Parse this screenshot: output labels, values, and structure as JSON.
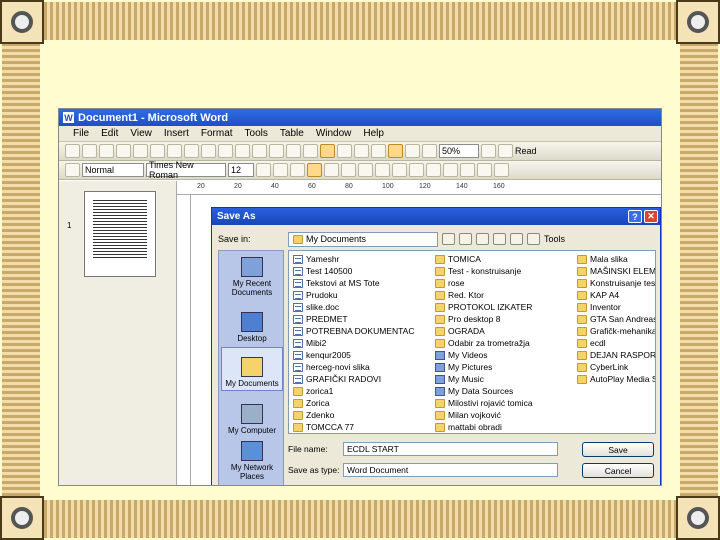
{
  "app": {
    "title": "Document1 - Microsoft Word",
    "icon": "word-app-icon"
  },
  "menu": [
    "File",
    "Edit",
    "View",
    "Insert",
    "Format",
    "Tools",
    "Table",
    "Window",
    "Help"
  ],
  "formatting": {
    "style": "Normal",
    "font": "Times New Roman",
    "size": "12",
    "zoom": "50%",
    "read_label": "Read"
  },
  "ruler": {
    "ticks": [
      "20",
      "20",
      "40",
      "60",
      "80",
      "100",
      "120",
      "140",
      "160"
    ]
  },
  "thumbnail": {
    "page_number": "1"
  },
  "dialog": {
    "title": "Save As",
    "save_in_label": "Save in:",
    "save_in_value": "My Documents",
    "tools_label": "Tools",
    "places": [
      "My Recent Documents",
      "Desktop",
      "My Documents",
      "My Computer",
      "My Network Places"
    ],
    "selected_place": "My Documents",
    "columns": [
      [
        {
          "name": "Yameshr",
          "type": "doc"
        },
        {
          "name": "Test 140500",
          "type": "doc"
        },
        {
          "name": "Tekstovi at MS Tote",
          "type": "doc"
        },
        {
          "name": "Prudoku",
          "type": "doc"
        },
        {
          "name": "slike.doc",
          "type": "doc"
        },
        {
          "name": "PREDMET",
          "type": "doc"
        },
        {
          "name": "POTREBNA DOKUMENTACIJA ZA UPIS",
          "type": "doc"
        },
        {
          "name": "Mibi2",
          "type": "doc"
        },
        {
          "name": "kenqur2005",
          "type": "doc"
        },
        {
          "name": "herceg-novi slika",
          "type": "doc"
        },
        {
          "name": "GRAFIČKI RADOVI",
          "type": "doc"
        },
        {
          "name": "zorica1",
          "type": "folder"
        },
        {
          "name": "Zorica",
          "type": "folder"
        },
        {
          "name": "Zdenko",
          "type": "folder"
        },
        {
          "name": "TOMCCA 77",
          "type": "folder"
        }
      ],
      [
        {
          "name": "TOMICA",
          "type": "folder"
        },
        {
          "name": "Test - konstruisanje",
          "type": "folder"
        },
        {
          "name": "rose",
          "type": "folder"
        },
        {
          "name": "Red. Ktor",
          "type": "folder"
        },
        {
          "name": "PROTOKOL IZKATER",
          "type": "folder"
        },
        {
          "name": "Pro desktop 8",
          "type": "folder"
        },
        {
          "name": "OGRADA",
          "type": "folder"
        },
        {
          "name": "Odabir za trometražja",
          "type": "folder"
        },
        {
          "name": "My Videos",
          "type": "special"
        },
        {
          "name": "My Pictures",
          "type": "special"
        },
        {
          "name": "My Music",
          "type": "special"
        },
        {
          "name": "My Data Sources",
          "type": "special"
        },
        {
          "name": "Milostivi rojavić tomica",
          "type": "folder"
        },
        {
          "name": "Milan vojković",
          "type": "folder"
        },
        {
          "name": "mattabi obradi",
          "type": "folder"
        }
      ],
      [
        {
          "name": "Mala slika",
          "type": "folder"
        },
        {
          "name": "MAŠINSKI ELEMENT",
          "type": "folder"
        },
        {
          "name": "Konstruisanje test",
          "type": "folder"
        },
        {
          "name": "KAP A4",
          "type": "folder"
        },
        {
          "name": "Inventor",
          "type": "folder"
        },
        {
          "name": "GTA San Andreas U",
          "type": "folder"
        },
        {
          "name": "Grafičk-mehanika",
          "type": "folder"
        },
        {
          "name": "ecdl",
          "type": "folder"
        },
        {
          "name": "DEJAN RASPORED",
          "type": "folder"
        },
        {
          "name": "CyberLink",
          "type": "folder"
        },
        {
          "name": "AutoPlay Media Stu",
          "type": "folder"
        }
      ]
    ],
    "file_name_label": "File name:",
    "file_name_value": "ECDL START",
    "save_type_label": "Save as type:",
    "save_type_value": "Word Document",
    "save_button": "Save",
    "cancel_button": "Cancel"
  }
}
